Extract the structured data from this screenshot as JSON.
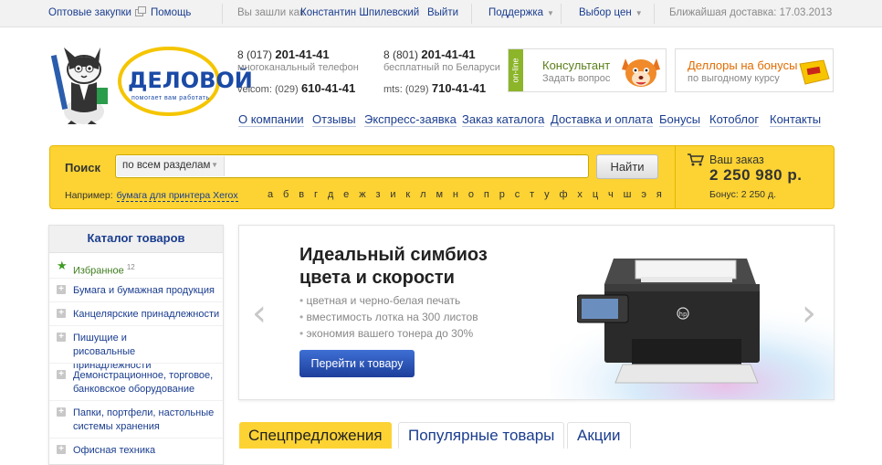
{
  "topbar": {
    "wholesale": "Оптовые закупки",
    "help": "Помощь",
    "logged_as": "Вы зашли как",
    "user": "Константин Шпилевский",
    "logout": "Выйти",
    "support": "Поддержка",
    "price_choice": "Выбор цен",
    "delivery": "Ближайшая доставка: 17.03.2013"
  },
  "logo": {
    "name": "ДЕЛОВОЙ",
    "tagline": "помогает вам работать"
  },
  "phones": [
    {
      "code": "8 (017)",
      "number": "201-41-41",
      "note": "многоканальный телефон"
    },
    {
      "code": "8 (801)",
      "number": "201-41-41",
      "note": "бесплатный по Беларуси"
    },
    {
      "code": "velcom: (029)",
      "number": "610-41-41"
    },
    {
      "code": "mts: (029)",
      "number": "710-41-41"
    }
  ],
  "consultant": {
    "badge": "on-line",
    "title": "Консультант",
    "subtitle": "Задать вопрос"
  },
  "bonus_box": {
    "title": "Деллоры на бонусы",
    "subtitle": "по выгодному курсу"
  },
  "nav": [
    "О компании",
    "Отзывы",
    "Экспресс-заявка",
    "Заказ каталога",
    "Доставка и оплата",
    "Бонусы",
    "Котоблог",
    "Контакты"
  ],
  "search": {
    "label": "Поиск",
    "scope": "по всем разделам",
    "placeholder": "",
    "button": "Найти",
    "example_label": "Например:",
    "example_link": "бумага для принтера Xerox",
    "alphabet": [
      "а",
      "б",
      "в",
      "г",
      "д",
      "е",
      "ж",
      "з",
      "и",
      "к",
      "л",
      "м",
      "н",
      "о",
      "п",
      "р",
      "с",
      "т",
      "у",
      "ф",
      "х",
      "ц",
      "ч",
      "ш",
      "э",
      "я"
    ]
  },
  "order": {
    "title": "Ваш заказ",
    "sum": "2 250 980 р.",
    "bonus": "Бонус: 2 250 д."
  },
  "catalog": {
    "title": "Каталог товаров",
    "favorites": "Избранное",
    "favorites_count": "12",
    "items": [
      "Бумага и бумажная продукция",
      "Канцелярские принадлежности",
      "Пишущие и рисовальные принадлежности",
      "Демонстрационное, торговое, банковское оборудование",
      "Папки, портфели, настольные системы хранения",
      "Офисная техника"
    ]
  },
  "banner": {
    "title_line1": "Идеальный симбиоз",
    "title_line2": "цвета и скорости",
    "bullets": [
      "цветная и черно-белая печать",
      "вместимость лотка на 300 листов",
      "экономия вашего тонера до 30%"
    ],
    "button": "Перейти к товару",
    "printer_brand": "hp"
  },
  "tabs": [
    "Спецпредложения",
    "Популярные товары",
    "Акции"
  ],
  "colors": {
    "accent_yellow": "#fcd333",
    "link_blue": "#1a3d8f",
    "button_blue": "#1d3f9b",
    "online_green": "#8cb52a"
  }
}
